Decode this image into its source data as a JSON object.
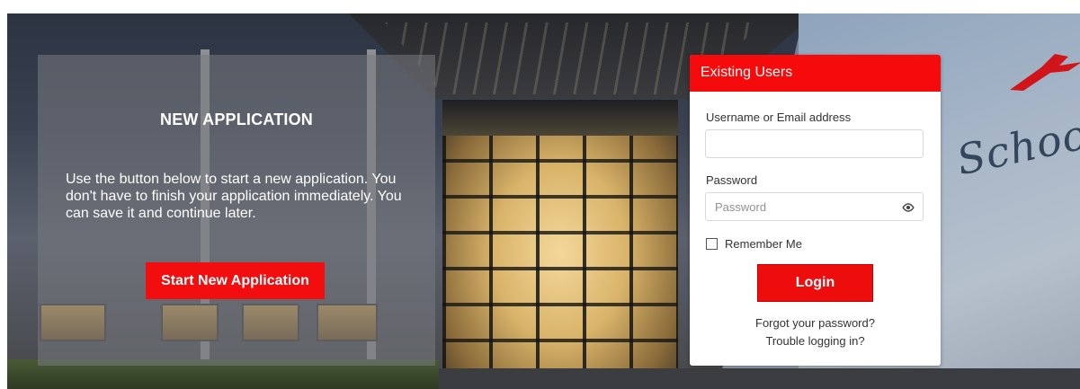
{
  "background": {
    "school_sign_text": "School"
  },
  "new_application": {
    "title": "NEW APPLICATION",
    "description": "Use the button below to start a new application. You don't have to finish your application immediately. You can save it and continue later.",
    "button_label": "Start New Application"
  },
  "login": {
    "header": "Existing Users",
    "username_label": "Username or Email address",
    "username_value": "",
    "username_placeholder": "",
    "password_label": "Password",
    "password_value": "",
    "password_placeholder": "Password",
    "remember_label": "Remember Me",
    "remember_checked": false,
    "login_button": "Login",
    "forgot_link": "Forgot your password?",
    "trouble_link": "Trouble logging in?",
    "show_password_icon": "eye-icon"
  },
  "colors": {
    "accent": "#f50b0b",
    "panel_overlay": "rgba(120,122,128,0.55)"
  }
}
